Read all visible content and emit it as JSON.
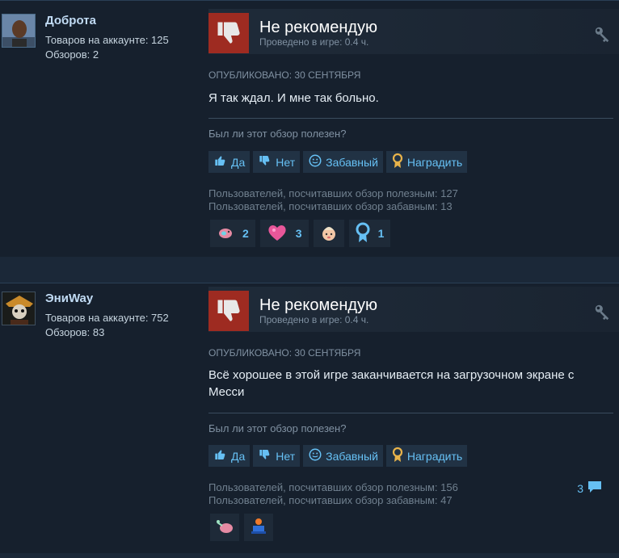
{
  "reviews": [
    {
      "username": "Доброта",
      "products": "Товаров на аккаунте: 125",
      "reviews_count": "Обзоров: 2",
      "verdict": "Не рекомендую",
      "hours": "Проведено в игре: 0.4 ч.",
      "posted": "ОПУБЛИКОВАНО: 30 СЕНТЯБРЯ",
      "text": "Я так ждал. И мне так больно.",
      "helpful_question": "Был ли этот обзор полезен?",
      "buttons": {
        "yes": "Да",
        "no": "Нет",
        "funny": "Забавный",
        "award": "Наградить"
      },
      "stat_helpful": "Пользователей, посчитавших обзор полезным: 127",
      "stat_funny": "Пользователей, посчитавших обзор забавным: 13",
      "awards": [
        {
          "icon": "pig-icon",
          "count": "2"
        },
        {
          "icon": "heart-icon",
          "count": "3"
        },
        {
          "icon": "baby-face-icon",
          "count": ""
        },
        {
          "icon": "ribbon-icon",
          "count": "1"
        }
      ]
    },
    {
      "username": "ЭниWay",
      "products": "Товаров на аккаунте: 752",
      "reviews_count": "Обзоров: 83",
      "verdict": "Не рекомендую",
      "hours": "Проведено в игре: 0.4 ч.",
      "posted": "ОПУБЛИКОВАНО: 30 СЕНТЯБРЯ",
      "text": "Всё хорошее в этой игре заканчивается на загрузочном экране с Месси",
      "helpful_question": "Был ли этот обзор полезен?",
      "buttons": {
        "yes": "Да",
        "no": "Нет",
        "funny": "Забавный",
        "award": "Наградить"
      },
      "stat_helpful": "Пользователей, посчитавших обзор полезным: 156",
      "stat_funny": "Пользователей, посчитавших обзор забавным: 47",
      "comments": "3",
      "awards": [
        {
          "icon": "brain-icon",
          "count": ""
        },
        {
          "icon": "trophy-icon",
          "count": ""
        }
      ]
    }
  ],
  "colors": {
    "accent": "#66c0f4",
    "thumb_down": "#9e2b21",
    "bg": "#16202d"
  }
}
